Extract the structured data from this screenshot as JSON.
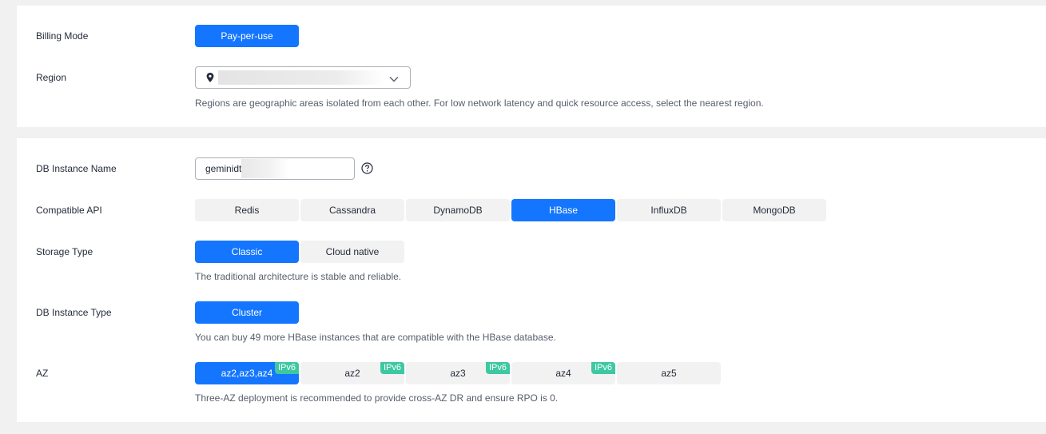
{
  "billing": {
    "label": "Billing Mode",
    "mode": "Pay-per-use"
  },
  "region": {
    "label": "Region",
    "hint": "Regions are geographic areas isolated from each other. For low network latency and quick resource access, select the nearest region."
  },
  "instance_name": {
    "label": "DB Instance Name",
    "value": "geminidt"
  },
  "compatible_api": {
    "label": "Compatible API",
    "options": [
      "Redis",
      "Cassandra",
      "DynamoDB",
      "HBase",
      "InfluxDB",
      "MongoDB"
    ],
    "selected": "HBase"
  },
  "storage_type": {
    "label": "Storage Type",
    "options": [
      "Classic",
      "Cloud native"
    ],
    "selected": "Classic",
    "hint": "The traditional architecture is stable and reliable."
  },
  "instance_type": {
    "label": "DB Instance Type",
    "value": "Cluster",
    "hint": "You can buy 49 more HBase instances that are compatible with the HBase database."
  },
  "az": {
    "label": "AZ",
    "options": [
      {
        "name": "az2,az3,az4",
        "tag": "IPv6"
      },
      {
        "name": "az2",
        "tag": "IPv6"
      },
      {
        "name": "az3",
        "tag": "IPv6"
      },
      {
        "name": "az4",
        "tag": "IPv6"
      },
      {
        "name": "az5",
        "tag": ""
      }
    ],
    "selected": "az2,az3,az4",
    "hint": "Three-AZ deployment is recommended to provide cross-AZ DR and ensure RPO is 0."
  },
  "colors": {
    "primary": "#1476ff",
    "ipv6_tag": "#3ec8a2",
    "segment_bg": "#f2f2f2"
  }
}
